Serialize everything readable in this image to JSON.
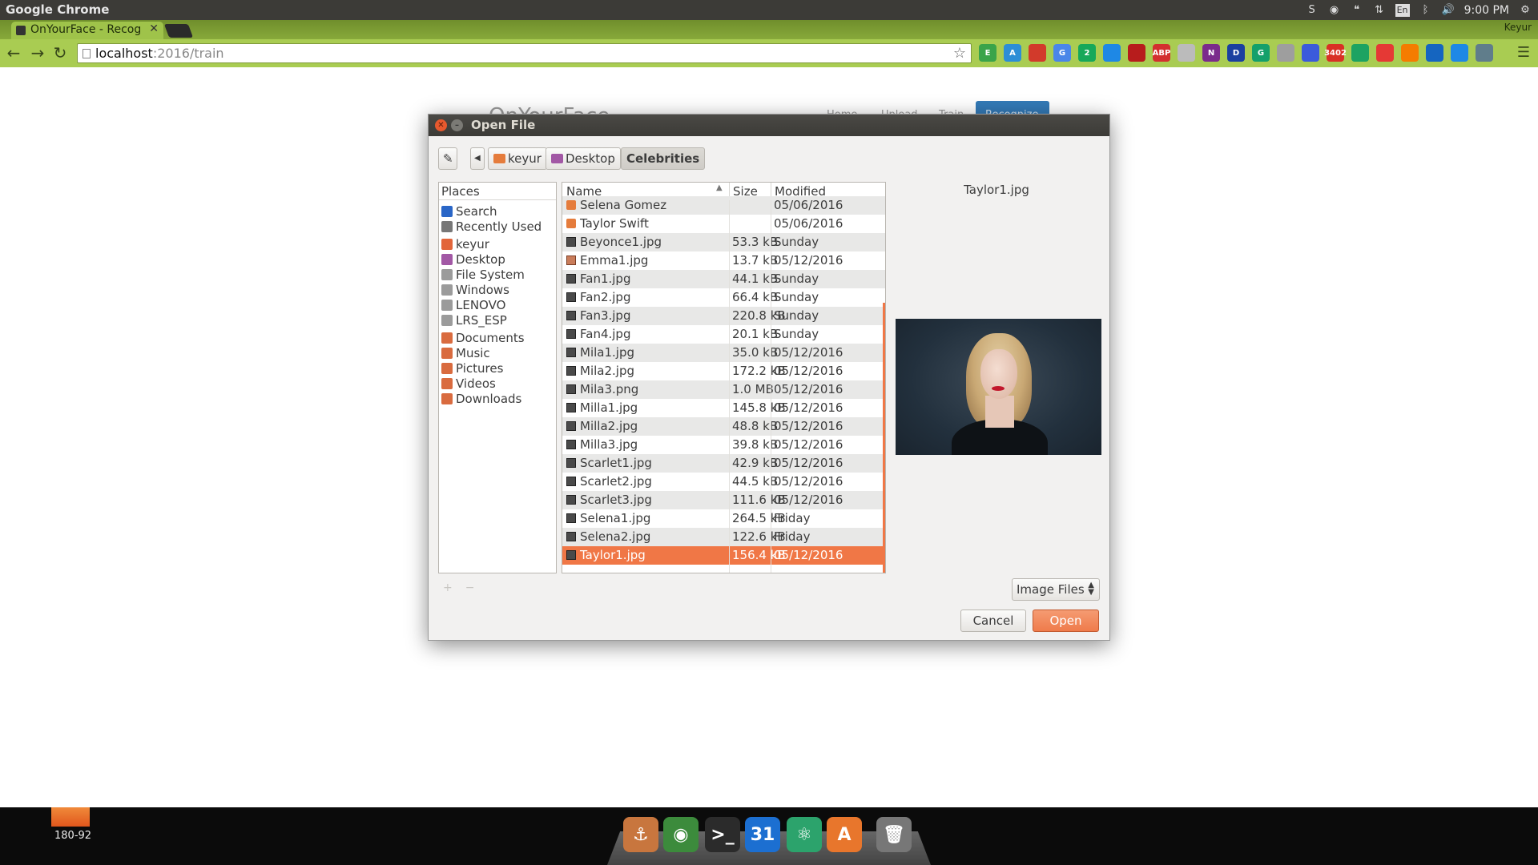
{
  "system": {
    "app_name": "Google Chrome",
    "keyboard_layout": "En",
    "clock": "9:00 PM"
  },
  "chrome": {
    "tab_title": "OnYourFace - Recog",
    "user": "Keyur",
    "url_host": "localhost",
    "url_path": ":2016/train",
    "extensions": [
      {
        "name": "evernote-icon",
        "color": "#3aa44a",
        "label": "E"
      },
      {
        "name": "translate-a-icon",
        "color": "#2c8ed6",
        "label": "A"
      },
      {
        "name": "bookmark-red-icon",
        "color": "#d23a2b",
        "label": ""
      },
      {
        "name": "google-translate-icon",
        "color": "#4a86e8",
        "label": "G"
      },
      {
        "name": "hangouts-icon",
        "color": "#17a85a",
        "label": "2"
      },
      {
        "name": "calendar-ext-icon",
        "color": "#1e88e5",
        "label": ""
      },
      {
        "name": "hat-icon",
        "color": "#b71c1c",
        "label": ""
      },
      {
        "name": "adblock-icon",
        "color": "#d32f2f",
        "label": "ABP"
      },
      {
        "name": "puzzle-icon",
        "color": "#bbbbbb",
        "label": ""
      },
      {
        "name": "onenote-icon",
        "color": "#7b2b8c",
        "label": "N"
      },
      {
        "name": "d-circle-icon",
        "color": "#1a3fa0",
        "label": "D"
      },
      {
        "name": "grammarly-icon",
        "color": "#14a06b",
        "label": "G"
      },
      {
        "name": "gray-dot-icon",
        "color": "#9e9e9e",
        "label": ""
      },
      {
        "name": "stack-icon",
        "color": "#3b5bdb",
        "label": ""
      },
      {
        "name": "gmail-icon",
        "color": "#d93025",
        "label": "3402"
      },
      {
        "name": "drive-icon",
        "color": "#1da362",
        "label": ""
      },
      {
        "name": "pocket-icon",
        "color": "#e53935",
        "label": ""
      },
      {
        "name": "carrot-icon",
        "color": "#f57c00",
        "label": ""
      },
      {
        "name": "pin-icon",
        "color": "#1565c0",
        "label": ""
      },
      {
        "name": "telegram-icon",
        "color": "#1e88e5",
        "label": ""
      },
      {
        "name": "screenshot-icon",
        "color": "#607d8b",
        "label": ""
      }
    ]
  },
  "page": {
    "brand": "OnYourFace",
    "nav": [
      "Home",
      "Upload",
      "Train",
      "Recognize"
    ]
  },
  "dialog": {
    "title": "Open File",
    "path": [
      "keyur",
      "Desktop",
      "Celebrities"
    ],
    "places_header": "Places",
    "places": [
      {
        "label": "Search",
        "icon": "search-icon",
        "color": "#2a66c7"
      },
      {
        "label": "Recently Used",
        "icon": "clock-icon",
        "color": "#777777"
      },
      {
        "label": "keyur",
        "icon": "home-folder-icon",
        "color": "#e2653a"
      },
      {
        "label": "Desktop",
        "icon": "desktop-folder-icon",
        "color": "#a258a5"
      },
      {
        "label": "File System",
        "icon": "drive-icon",
        "color": "#9b9b9b"
      },
      {
        "label": "Windows",
        "icon": "drive-icon",
        "color": "#9b9b9b"
      },
      {
        "label": "LENOVO",
        "icon": "drive-icon",
        "color": "#9b9b9b"
      },
      {
        "label": "LRS_ESP",
        "icon": "drive-icon",
        "color": "#9b9b9b"
      },
      {
        "label": "Documents",
        "icon": "documents-folder-icon",
        "color": "#d96b3f"
      },
      {
        "label": "Music",
        "icon": "music-folder-icon",
        "color": "#d96b3f"
      },
      {
        "label": "Pictures",
        "icon": "pictures-folder-icon",
        "color": "#d96b3f"
      },
      {
        "label": "Videos",
        "icon": "videos-folder-icon",
        "color": "#d96b3f"
      },
      {
        "label": "Downloads",
        "icon": "downloads-folder-icon",
        "color": "#d96b3f"
      }
    ],
    "columns": {
      "name": "Name",
      "size": "Size",
      "modified": "Modified"
    },
    "files": [
      {
        "name": "Selena Gomez",
        "size": "",
        "modified": "05/06/2016",
        "type": "dir"
      },
      {
        "name": "Taylor Swift",
        "size": "",
        "modified": "05/06/2016",
        "type": "dir"
      },
      {
        "name": "Beyonce1.jpg",
        "size": "53.3 kB",
        "modified": "Sunday",
        "type": "img"
      },
      {
        "name": "Emma1.jpg",
        "size": "13.7 kB",
        "modified": "05/12/2016",
        "type": "photo"
      },
      {
        "name": "Fan1.jpg",
        "size": "44.1 kB",
        "modified": "Sunday",
        "type": "img"
      },
      {
        "name": "Fan2.jpg",
        "size": "66.4 kB",
        "modified": "Sunday",
        "type": "img"
      },
      {
        "name": "Fan3.jpg",
        "size": "220.8 kB",
        "modified": "Sunday",
        "type": "img"
      },
      {
        "name": "Fan4.jpg",
        "size": "20.1 kB",
        "modified": "Sunday",
        "type": "img"
      },
      {
        "name": "Mila1.jpg",
        "size": "35.0 kB",
        "modified": "05/12/2016",
        "type": "img"
      },
      {
        "name": "Mila2.jpg",
        "size": "172.2 kB",
        "modified": "05/12/2016",
        "type": "img"
      },
      {
        "name": "Mila3.png",
        "size": "1.0 MB",
        "modified": "05/12/2016",
        "type": "img"
      },
      {
        "name": "Milla1.jpg",
        "size": "145.8 kB",
        "modified": "05/12/2016",
        "type": "img"
      },
      {
        "name": "Milla2.jpg",
        "size": "48.8 kB",
        "modified": "05/12/2016",
        "type": "img"
      },
      {
        "name": "Milla3.jpg",
        "size": "39.8 kB",
        "modified": "05/12/2016",
        "type": "img"
      },
      {
        "name": "Scarlet1.jpg",
        "size": "42.9 kB",
        "modified": "05/12/2016",
        "type": "img"
      },
      {
        "name": "Scarlet2.jpg",
        "size": "44.5 kB",
        "modified": "05/12/2016",
        "type": "img"
      },
      {
        "name": "Scarlet3.jpg",
        "size": "111.6 kB",
        "modified": "05/12/2016",
        "type": "img"
      },
      {
        "name": "Selena1.jpg",
        "size": "264.5 kB",
        "modified": "Friday",
        "type": "img"
      },
      {
        "name": "Selena2.jpg",
        "size": "122.6 kB",
        "modified": "Friday",
        "type": "img"
      },
      {
        "name": "Taylor1.jpg",
        "size": "156.4 kB",
        "modified": "05/12/2016",
        "type": "img",
        "selected": true
      }
    ],
    "preview_name": "Taylor1.jpg",
    "filter": "Image Files",
    "cancel_label": "Cancel",
    "open_label": "Open"
  },
  "dock": {
    "workspace_label": "180-92",
    "apps": [
      {
        "name": "anchor-app-icon",
        "color": "#c8763e",
        "label": "⚓"
      },
      {
        "name": "chrome-app-icon",
        "color": "#3c8b3c",
        "label": "◉"
      },
      {
        "name": "terminal-app-icon",
        "color": "#2b2b2b",
        "label": ">_"
      },
      {
        "name": "calendar-app-icon",
        "color": "#1c6fd1",
        "label": "31"
      },
      {
        "name": "atom-app-icon",
        "color": "#2ca36c",
        "label": "⚛"
      },
      {
        "name": "software-center-app-icon",
        "color": "#e8762c",
        "label": "A"
      },
      {
        "name": "trash-app-icon",
        "color": "#777777",
        "label": "🗑"
      }
    ]
  },
  "colors": {
    "accent": "#f07746",
    "chrome_green": "#a9cc52"
  }
}
